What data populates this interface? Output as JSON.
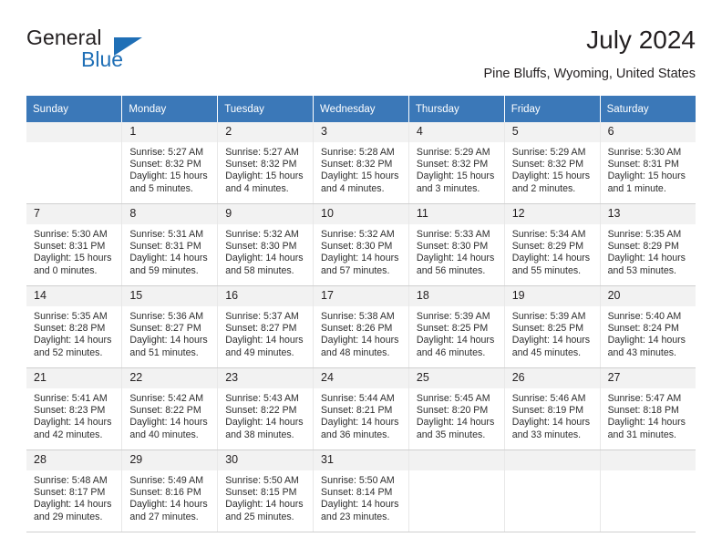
{
  "brand": {
    "name_part1": "General",
    "name_part2": "Blue",
    "triangle_color": "#1f6fb6"
  },
  "header": {
    "title": "July 2024",
    "location": "Pine Bluffs, Wyoming, United States"
  },
  "theme": {
    "header_blue": "#3b78b8",
    "date_band_gray": "#f2f2f2",
    "text_color": "#231f20"
  },
  "calendar": {
    "weekday_headers": [
      "Sunday",
      "Monday",
      "Tuesday",
      "Wednesday",
      "Thursday",
      "Friday",
      "Saturday"
    ],
    "weeks": [
      [
        {
          "day": "",
          "sunrise": "",
          "sunset": "",
          "daylight_line1": "",
          "daylight_line2": ""
        },
        {
          "day": "1",
          "sunrise": "Sunrise: 5:27 AM",
          "sunset": "Sunset: 8:32 PM",
          "daylight_line1": "Daylight: 15 hours",
          "daylight_line2": "and 5 minutes."
        },
        {
          "day": "2",
          "sunrise": "Sunrise: 5:27 AM",
          "sunset": "Sunset: 8:32 PM",
          "daylight_line1": "Daylight: 15 hours",
          "daylight_line2": "and 4 minutes."
        },
        {
          "day": "3",
          "sunrise": "Sunrise: 5:28 AM",
          "sunset": "Sunset: 8:32 PM",
          "daylight_line1": "Daylight: 15 hours",
          "daylight_line2": "and 4 minutes."
        },
        {
          "day": "4",
          "sunrise": "Sunrise: 5:29 AM",
          "sunset": "Sunset: 8:32 PM",
          "daylight_line1": "Daylight: 15 hours",
          "daylight_line2": "and 3 minutes."
        },
        {
          "day": "5",
          "sunrise": "Sunrise: 5:29 AM",
          "sunset": "Sunset: 8:32 PM",
          "daylight_line1": "Daylight: 15 hours",
          "daylight_line2": "and 2 minutes."
        },
        {
          "day": "6",
          "sunrise": "Sunrise: 5:30 AM",
          "sunset": "Sunset: 8:31 PM",
          "daylight_line1": "Daylight: 15 hours",
          "daylight_line2": "and 1 minute."
        }
      ],
      [
        {
          "day": "7",
          "sunrise": "Sunrise: 5:30 AM",
          "sunset": "Sunset: 8:31 PM",
          "daylight_line1": "Daylight: 15 hours",
          "daylight_line2": "and 0 minutes."
        },
        {
          "day": "8",
          "sunrise": "Sunrise: 5:31 AM",
          "sunset": "Sunset: 8:31 PM",
          "daylight_line1": "Daylight: 14 hours",
          "daylight_line2": "and 59 minutes."
        },
        {
          "day": "9",
          "sunrise": "Sunrise: 5:32 AM",
          "sunset": "Sunset: 8:30 PM",
          "daylight_line1": "Daylight: 14 hours",
          "daylight_line2": "and 58 minutes."
        },
        {
          "day": "10",
          "sunrise": "Sunrise: 5:32 AM",
          "sunset": "Sunset: 8:30 PM",
          "daylight_line1": "Daylight: 14 hours",
          "daylight_line2": "and 57 minutes."
        },
        {
          "day": "11",
          "sunrise": "Sunrise: 5:33 AM",
          "sunset": "Sunset: 8:30 PM",
          "daylight_line1": "Daylight: 14 hours",
          "daylight_line2": "and 56 minutes."
        },
        {
          "day": "12",
          "sunrise": "Sunrise: 5:34 AM",
          "sunset": "Sunset: 8:29 PM",
          "daylight_line1": "Daylight: 14 hours",
          "daylight_line2": "and 55 minutes."
        },
        {
          "day": "13",
          "sunrise": "Sunrise: 5:35 AM",
          "sunset": "Sunset: 8:29 PM",
          "daylight_line1": "Daylight: 14 hours",
          "daylight_line2": "and 53 minutes."
        }
      ],
      [
        {
          "day": "14",
          "sunrise": "Sunrise: 5:35 AM",
          "sunset": "Sunset: 8:28 PM",
          "daylight_line1": "Daylight: 14 hours",
          "daylight_line2": "and 52 minutes."
        },
        {
          "day": "15",
          "sunrise": "Sunrise: 5:36 AM",
          "sunset": "Sunset: 8:27 PM",
          "daylight_line1": "Daylight: 14 hours",
          "daylight_line2": "and 51 minutes."
        },
        {
          "day": "16",
          "sunrise": "Sunrise: 5:37 AM",
          "sunset": "Sunset: 8:27 PM",
          "daylight_line1": "Daylight: 14 hours",
          "daylight_line2": "and 49 minutes."
        },
        {
          "day": "17",
          "sunrise": "Sunrise: 5:38 AM",
          "sunset": "Sunset: 8:26 PM",
          "daylight_line1": "Daylight: 14 hours",
          "daylight_line2": "and 48 minutes."
        },
        {
          "day": "18",
          "sunrise": "Sunrise: 5:39 AM",
          "sunset": "Sunset: 8:25 PM",
          "daylight_line1": "Daylight: 14 hours",
          "daylight_line2": "and 46 minutes."
        },
        {
          "day": "19",
          "sunrise": "Sunrise: 5:39 AM",
          "sunset": "Sunset: 8:25 PM",
          "daylight_line1": "Daylight: 14 hours",
          "daylight_line2": "and 45 minutes."
        },
        {
          "day": "20",
          "sunrise": "Sunrise: 5:40 AM",
          "sunset": "Sunset: 8:24 PM",
          "daylight_line1": "Daylight: 14 hours",
          "daylight_line2": "and 43 minutes."
        }
      ],
      [
        {
          "day": "21",
          "sunrise": "Sunrise: 5:41 AM",
          "sunset": "Sunset: 8:23 PM",
          "daylight_line1": "Daylight: 14 hours",
          "daylight_line2": "and 42 minutes."
        },
        {
          "day": "22",
          "sunrise": "Sunrise: 5:42 AM",
          "sunset": "Sunset: 8:22 PM",
          "daylight_line1": "Daylight: 14 hours",
          "daylight_line2": "and 40 minutes."
        },
        {
          "day": "23",
          "sunrise": "Sunrise: 5:43 AM",
          "sunset": "Sunset: 8:22 PM",
          "daylight_line1": "Daylight: 14 hours",
          "daylight_line2": "and 38 minutes."
        },
        {
          "day": "24",
          "sunrise": "Sunrise: 5:44 AM",
          "sunset": "Sunset: 8:21 PM",
          "daylight_line1": "Daylight: 14 hours",
          "daylight_line2": "and 36 minutes."
        },
        {
          "day": "25",
          "sunrise": "Sunrise: 5:45 AM",
          "sunset": "Sunset: 8:20 PM",
          "daylight_line1": "Daylight: 14 hours",
          "daylight_line2": "and 35 minutes."
        },
        {
          "day": "26",
          "sunrise": "Sunrise: 5:46 AM",
          "sunset": "Sunset: 8:19 PM",
          "daylight_line1": "Daylight: 14 hours",
          "daylight_line2": "and 33 minutes."
        },
        {
          "day": "27",
          "sunrise": "Sunrise: 5:47 AM",
          "sunset": "Sunset: 8:18 PM",
          "daylight_line1": "Daylight: 14 hours",
          "daylight_line2": "and 31 minutes."
        }
      ],
      [
        {
          "day": "28",
          "sunrise": "Sunrise: 5:48 AM",
          "sunset": "Sunset: 8:17 PM",
          "daylight_line1": "Daylight: 14 hours",
          "daylight_line2": "and 29 minutes."
        },
        {
          "day": "29",
          "sunrise": "Sunrise: 5:49 AM",
          "sunset": "Sunset: 8:16 PM",
          "daylight_line1": "Daylight: 14 hours",
          "daylight_line2": "and 27 minutes."
        },
        {
          "day": "30",
          "sunrise": "Sunrise: 5:50 AM",
          "sunset": "Sunset: 8:15 PM",
          "daylight_line1": "Daylight: 14 hours",
          "daylight_line2": "and 25 minutes."
        },
        {
          "day": "31",
          "sunrise": "Sunrise: 5:50 AM",
          "sunset": "Sunset: 8:14 PM",
          "daylight_line1": "Daylight: 14 hours",
          "daylight_line2": "and 23 minutes."
        },
        {
          "day": "",
          "sunrise": "",
          "sunset": "",
          "daylight_line1": "",
          "daylight_line2": ""
        },
        {
          "day": "",
          "sunrise": "",
          "sunset": "",
          "daylight_line1": "",
          "daylight_line2": ""
        },
        {
          "day": "",
          "sunrise": "",
          "sunset": "",
          "daylight_line1": "",
          "daylight_line2": ""
        }
      ]
    ]
  }
}
